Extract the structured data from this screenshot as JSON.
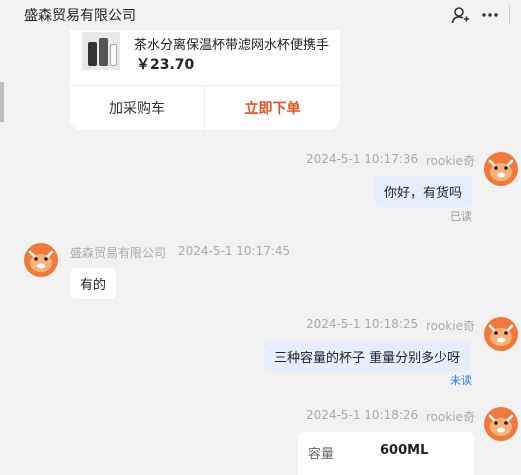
{
  "header": {
    "title": "盛森贸易有限公司",
    "icons": [
      "user-icon",
      "more-icon"
    ]
  },
  "product": {
    "name": "茶水分离保温杯带滤网水杯便携手",
    "price": "￥23.70",
    "add_to_cart": "加采购车",
    "order_now": "立即下单"
  },
  "messages": [
    {
      "sender": "rookie奇",
      "time": "2024-5-1 10:17:36",
      "text": "你好，有货吗",
      "status": "已读"
    },
    {
      "sender": "盛森贸易有限公司",
      "time": "2024-5-1 10:17:45",
      "text": "有的"
    },
    {
      "sender": "rookie奇",
      "time": "2024-5-1 10:18:25",
      "text": "三种容量的杯子 重量分别多少呀",
      "status": "未读"
    },
    {
      "sender": "rookie奇",
      "time": "2024-5-1 10:18:26",
      "spec": {
        "label": "容量",
        "value": "600ML"
      }
    }
  ],
  "colors": {
    "background": "#f2f2f2",
    "my_bubble": "#e6edff",
    "order_accent": "#e8521f",
    "unread": "#2e7df6",
    "avatar": "#f07a3c"
  }
}
